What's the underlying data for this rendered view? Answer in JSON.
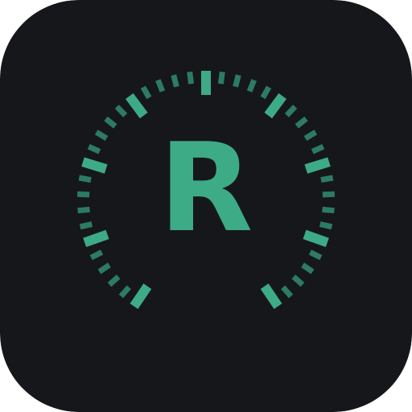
{
  "icon": {
    "letter": "R",
    "background_color": "#16171b",
    "accent_color": "#3dab86",
    "tick_color": "#2c7b62",
    "symbol": "tachometer-dial-icon"
  }
}
